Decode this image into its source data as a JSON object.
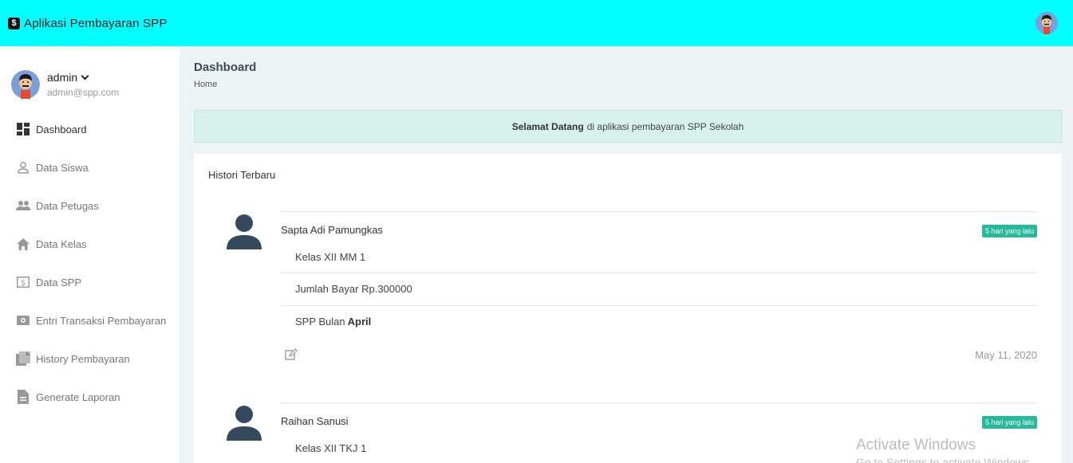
{
  "app": {
    "title": "Aplikasi Pembayaran SPP",
    "logo_glyph": "$"
  },
  "user": {
    "name": "admin",
    "email": "admin@spp.com"
  },
  "nav": [
    {
      "label": "Dashboard",
      "icon": "dashboard-icon",
      "active": true
    },
    {
      "label": "Data Siswa",
      "icon": "person-icon"
    },
    {
      "label": "Data Petugas",
      "icon": "people-icon"
    },
    {
      "label": "Data Kelas",
      "icon": "home-icon"
    },
    {
      "label": "Data SPP",
      "icon": "dollar-box-icon"
    },
    {
      "label": "Entri Transaksi Pembayaran",
      "icon": "money-icon"
    },
    {
      "label": "History Pembayaran",
      "icon": "files-icon"
    },
    {
      "label": "Generate Laporan",
      "icon": "document-icon"
    }
  ],
  "page": {
    "title": "Dashboard",
    "breadcrumb": "Home"
  },
  "alert": {
    "bold": "Selamat Datang",
    "text": "di aplikasi pembayaran SPP Sekolah"
  },
  "history": {
    "title": "Histori Terbaru",
    "entries": [
      {
        "name": "Sapta Adi Pamungkas",
        "badge": "5 hari yang lalu",
        "kelas": "Kelas XII MM 1",
        "jumlah": "Jumlah Bayar Rp.300000",
        "bulan_prefix": "SPP Bulan",
        "bulan": "April",
        "date": "May 11, 2020"
      },
      {
        "name": "Raihan Sanusi",
        "badge": "5 hari yang lalu",
        "kelas": "Kelas XII TKJ 1"
      }
    ]
  },
  "watermark": {
    "line1": "Activate Windows",
    "line2": "Go to Settings to activate Windows."
  },
  "colors": {
    "topbar": "#00ffff",
    "accent": "#26b99a",
    "alert_bg": "#d7f1ec"
  }
}
